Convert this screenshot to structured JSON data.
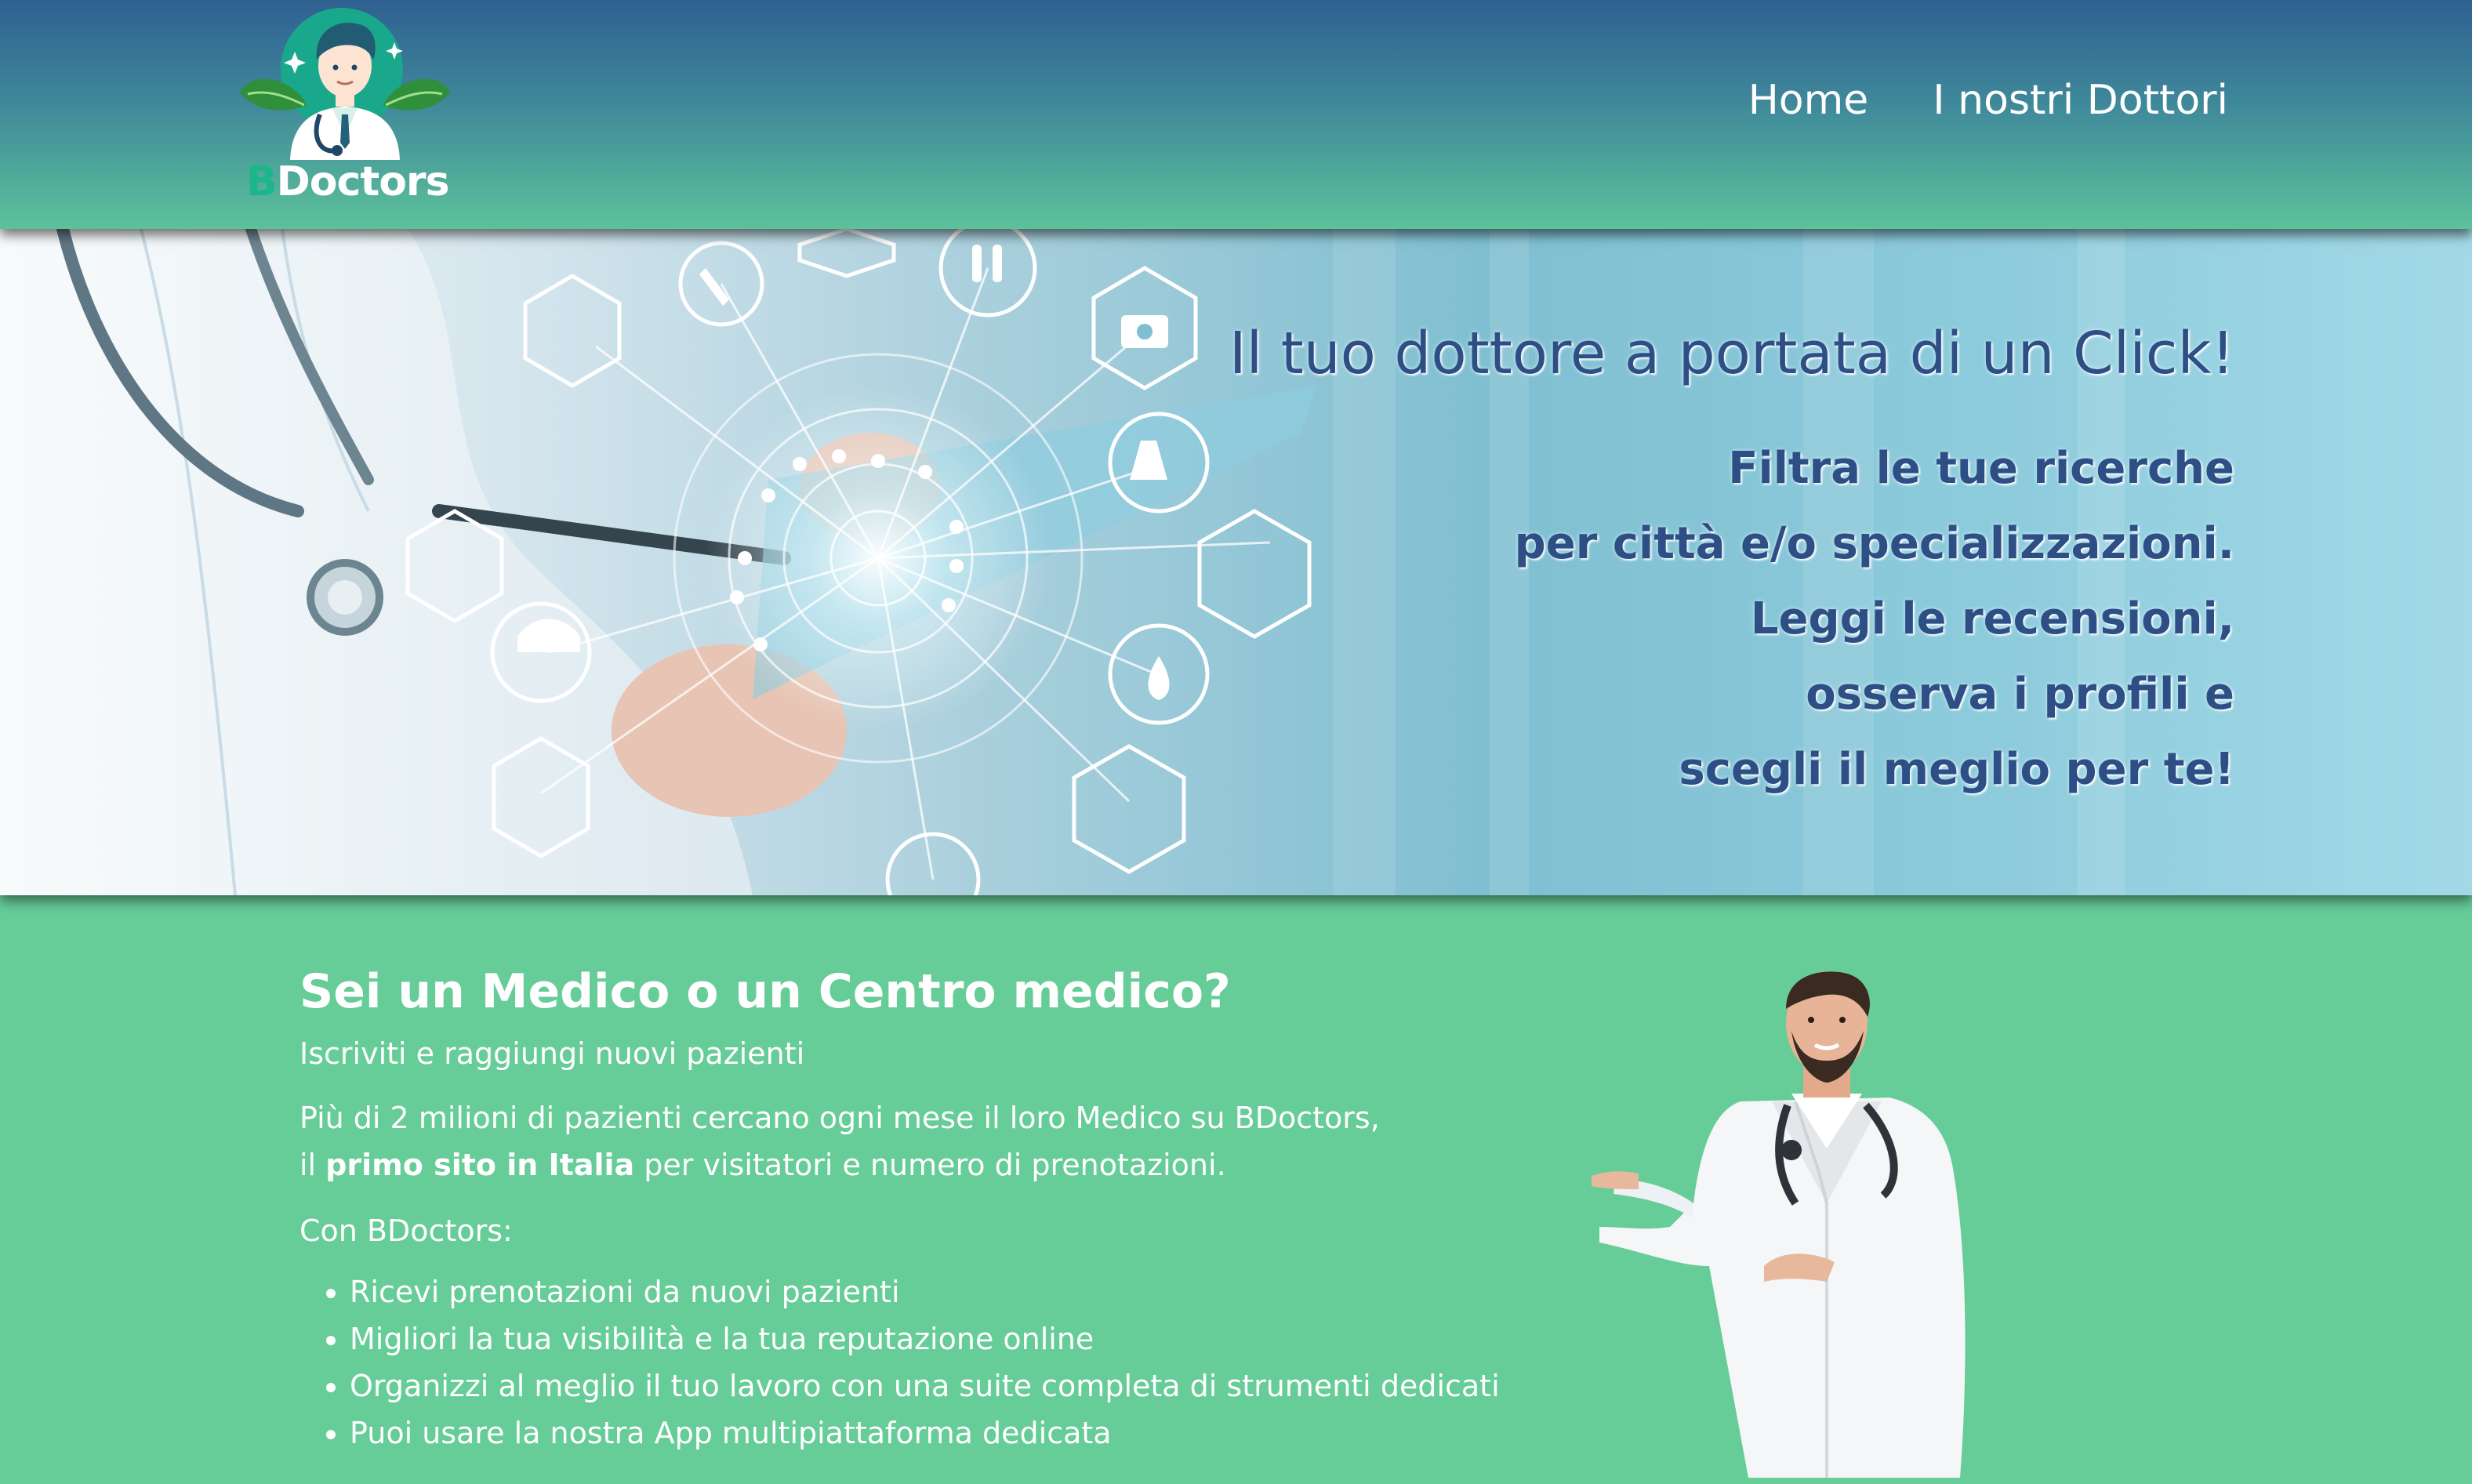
{
  "header": {
    "logo": {
      "text_b": "B",
      "text_rest": "Doctors"
    },
    "nav": [
      {
        "label": "Home"
      },
      {
        "label": "I nostri Dottori"
      }
    ]
  },
  "hero": {
    "title": "Il tuo dottore a portata di un Click!",
    "lines": [
      "Filtra le tue ricerche",
      "per città e/o specializzazioni.",
      "Leggi le recensioni,",
      "osserva i profili e",
      "scegli il meglio per te!"
    ]
  },
  "content": {
    "heading": "Sei un Medico o un Centro medico?",
    "subtitle": "Iscriviti e raggiungi nuovi pazienti",
    "para_line1": "Più di 2 milioni di pazienti cercano ogni mese il loro Medico su BDoctors,",
    "para_line2_prefix": "il ",
    "para_line2_bold": "primo sito in Italia",
    "para_line2_suffix": " per visitatori e numero di prenotazioni.",
    "con_label": "Con BDoctors:",
    "benefits": [
      "Ricevi prenotazioni da nuovi pazienti",
      "Migliori la tua visibilità e la tua reputazione online",
      "Organizzi al meglio il tuo lavoro con una suite completa di strumenti dedicati",
      "Puoi usare la nostra App multipiattaforma dedicata"
    ]
  },
  "colors": {
    "background": "#66cc98",
    "header_top": "#2f6092",
    "hero_text": "#2d4f86",
    "logo_accent": "#1bb78a"
  }
}
